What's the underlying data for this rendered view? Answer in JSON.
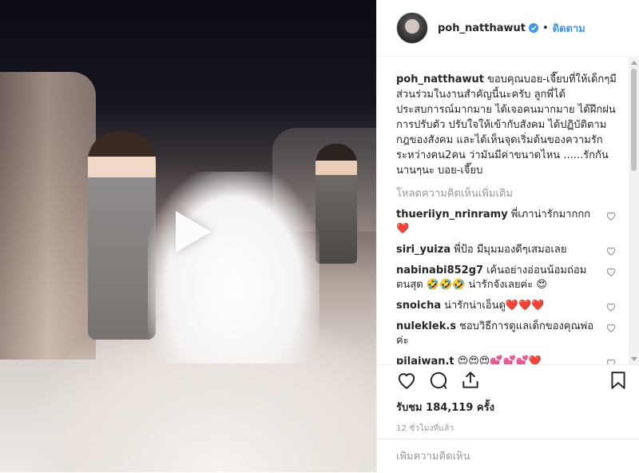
{
  "header": {
    "username": "poh_natthawut",
    "separator": "•",
    "follow_label": "ติดตาม"
  },
  "caption": {
    "username": "poh_natthawut",
    "text": "ขอบคุณบอย-เจี๊ยบที่ให้เด็กๆมีส่วนร่วมในงานสำคัญนี้นะครับ ลูกพี่ได้ประสบการณ์มากมาย ได้เจอคนมากมาย ได้ฝึกฝนการปรับตัว ปรับใจให้เข้ากับสังคม ได้ปฏิบัติตามกฎของสังคม และได้เห็นจุดเริ่มต้นของความรัก ระหว่างคน2คน ว่ามันมีค่าขนาดไหน ......รักกันนานๆนะ บอย-เจี๊ยบ"
  },
  "load_more": "โหลดความคิดเห็นเพิ่มเติม",
  "comments": [
    {
      "username": "thueriiyn_nrinramy",
      "text": "พี่เภาน่ารักมากกก ❤️"
    },
    {
      "username": "siri_yuiza",
      "text": "พี่ป้อ มีมุมมองดีๆเสมอเลย"
    },
    {
      "username": "nabinabi852g7",
      "text": "เค้นอย่างอ่อนน้อมถ่อมตนสุด 🤣🤣🤣 น่ารักจังเลยค่ะ 😍"
    },
    {
      "username": "snoicha",
      "text": "น่ารักน่าเอ็นดู❤️❤️❤️"
    },
    {
      "username": "nuleklek.s",
      "text": "ชอบวิธีการดูแลเด็กของคุณพ่อค่ะ"
    },
    {
      "username": "pilaiwan.t",
      "text": "😍😍😍💕💕💕❤️"
    }
  ],
  "views": "รับชม 184,119 ครั้ง",
  "timestamp": "12 ชั่วโมงที่แล้ว",
  "add_comment": {
    "placeholder": "เพิ่มความคิดเห็น"
  },
  "colors": {
    "link": "#3897f0",
    "heart": "#e0245e",
    "muted": "#999999"
  },
  "icons": {
    "like": "heart-outline-icon",
    "comment": "comment-bubble-icon",
    "share": "share-icon",
    "save": "bookmark-icon",
    "play": "play-icon",
    "verified": "verified-badge-icon"
  }
}
